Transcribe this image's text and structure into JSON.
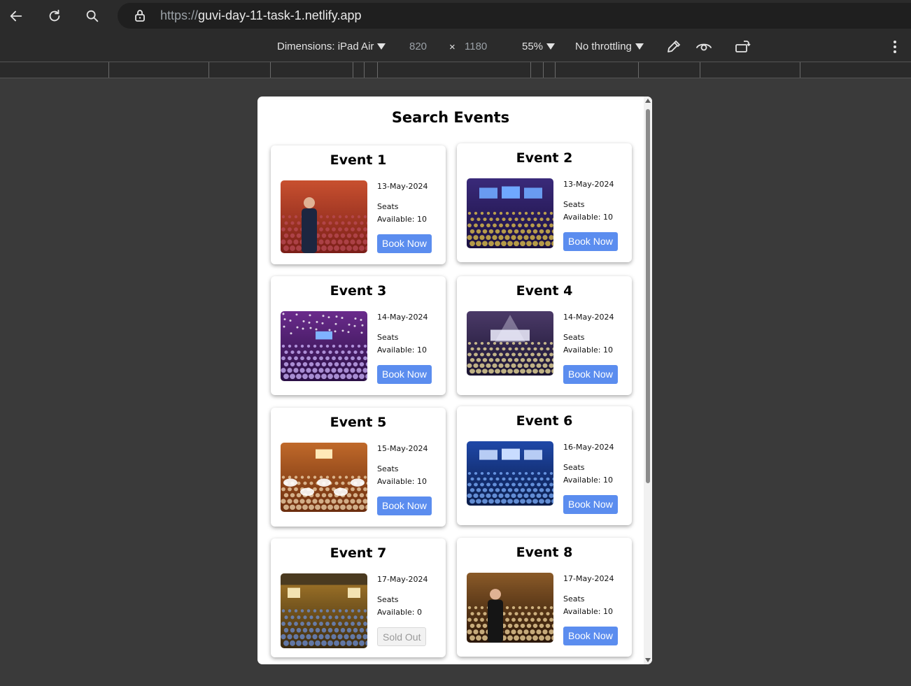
{
  "browser": {
    "url_protocol": "https://",
    "url_host": "guvi-day-11-task-1.netlify.app",
    "icons": {
      "back": "arrow-left-icon",
      "reload": "reload-icon",
      "search": "search-icon",
      "lock": "lock-icon"
    }
  },
  "devtools": {
    "dimensions_label": "Dimensions: iPad Air",
    "width": "820",
    "times": "×",
    "height": "1180",
    "zoom": "55%",
    "throttling": "No throttling",
    "icons": [
      "eyedropper-icon",
      "vision-icon",
      "rotate-icon",
      "more-vert-icon"
    ]
  },
  "page": {
    "title": "Search Events",
    "seats_prefix": "Seats",
    "events": [
      {
        "name": "Event 1",
        "date": "13-May-2024",
        "seats_label": "Available: 10",
        "button": "Book Now",
        "sold_out": false,
        "theme": "speaker"
      },
      {
        "name": "Event 2",
        "date": "13-May-2024",
        "seats_label": "Available: 10",
        "button": "Book Now",
        "sold_out": false,
        "theme": "hall"
      },
      {
        "name": "Event 3",
        "date": "14-May-2024",
        "seats_label": "Available: 10",
        "button": "Book Now",
        "sold_out": false,
        "theme": "lights"
      },
      {
        "name": "Event 4",
        "date": "14-May-2024",
        "seats_label": "Available: 10",
        "button": "Book Now",
        "sold_out": false,
        "theme": "concert"
      },
      {
        "name": "Event 5",
        "date": "15-May-2024",
        "seats_label": "Available: 10",
        "button": "Book Now",
        "sold_out": false,
        "theme": "banquet"
      },
      {
        "name": "Event 6",
        "date": "16-May-2024",
        "seats_label": "Available: 10",
        "button": "Book Now",
        "sold_out": false,
        "theme": "blue"
      },
      {
        "name": "Event 7",
        "date": "17-May-2024",
        "seats_label": "Available: 0",
        "button": "Sold Out",
        "sold_out": true,
        "theme": "crowd"
      },
      {
        "name": "Event 8",
        "date": "17-May-2024",
        "seats_label": "Available: 10",
        "button": "Book Now",
        "sold_out": false,
        "theme": "presenter"
      }
    ]
  },
  "colors": {
    "book_button": "#5b8def",
    "sold_out_button": "#f2f2f2",
    "page_bg": "#3a3a3a"
  }
}
